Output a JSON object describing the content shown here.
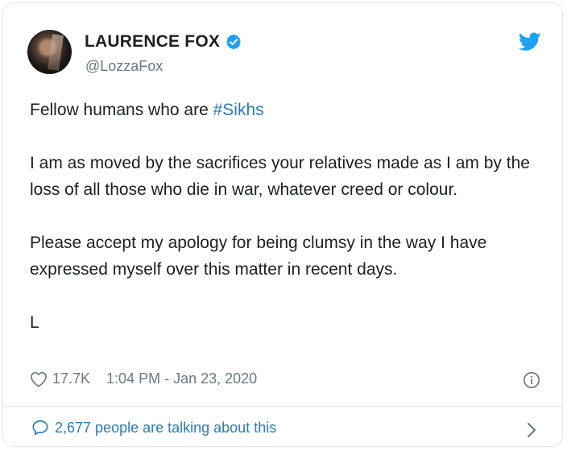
{
  "tweet": {
    "author_name": "LAURENCE FOX",
    "handle": "@LozzaFox",
    "body_prefix": "Fellow humans who are ",
    "hashtag": "#Sikhs",
    "paragraph2": "I am as moved by the sacrifices your relatives made as I am by the loss of all those who die in war, whatever creed or colour.",
    "paragraph3": "Please accept my apology for being clumsy in the way I have expressed myself over this matter in recent days.",
    "signoff": "L",
    "likes": "17.7K",
    "timestamp": "1:04 PM - Jan 23, 2020",
    "talking": "2,677 people are talking about this"
  },
  "icons": {
    "verified": "verified-badge-icon",
    "twitter": "twitter-bird-icon",
    "heart": "heart-icon",
    "info": "info-icon",
    "reply": "speech-bubble-icon",
    "chevron": "chevron-right-icon"
  },
  "colors": {
    "accent": "#1da1f2",
    "link": "#2b7bb9",
    "muted": "#697882",
    "text": "#1c2022",
    "border": "#e1e8ed"
  }
}
